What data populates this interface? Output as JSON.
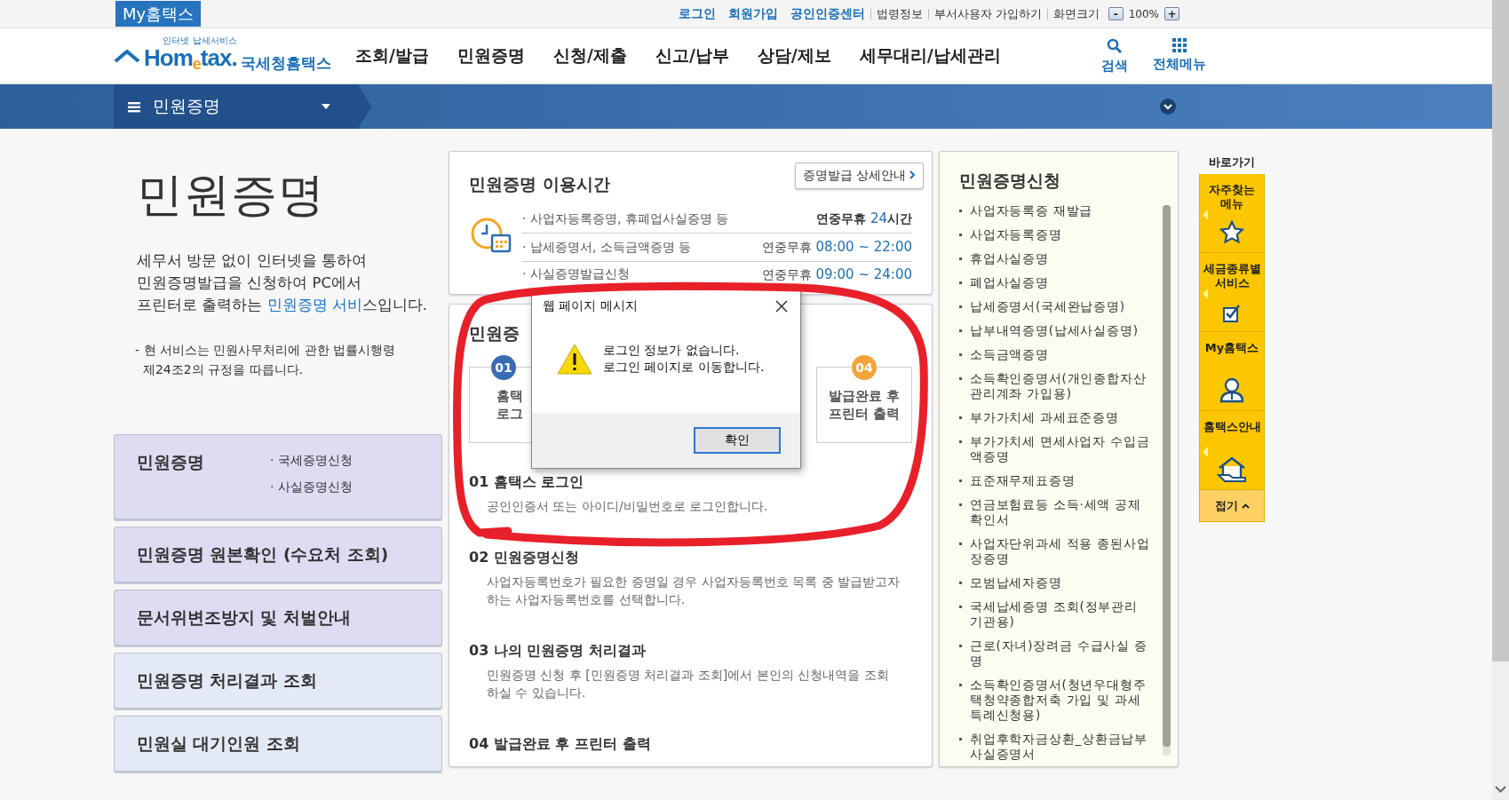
{
  "top_bar": {
    "badge": "My홈택스",
    "links": [
      {
        "label": "로그인",
        "kind": "primary"
      },
      {
        "label": "회원가입",
        "kind": "primary"
      },
      {
        "label": "공인인증센터",
        "kind": "primary"
      },
      {
        "label": "법령정보",
        "kind": "plain"
      },
      {
        "label": "부서사용자 가입하기",
        "kind": "plain"
      },
      {
        "label": "화면크기",
        "kind": "plain"
      }
    ],
    "zoom": {
      "minus": "-",
      "value": "100%",
      "plus": "+"
    }
  },
  "header": {
    "logo_tagline": "인터넷 납세서비스",
    "logo": "Hom$_{e}$tax.",
    "logo_name": "국세청홈택스",
    "nav": [
      "조회/발급",
      "민원증명",
      "신청/제출",
      "신고/납부",
      "상담/제보",
      "세무대리/납세관리"
    ],
    "tools": [
      {
        "label": "검색",
        "kind": "search"
      },
      {
        "label": "전체메뉴",
        "kind": "grid"
      }
    ]
  },
  "breadcrumb": {
    "label": "민원증명"
  },
  "intro": {
    "title": "민원증명",
    "description": "세무서 방문 없이 인터넷을 통하여\n민원증명발급을 신청하여 PC에서\n프린터로 출력하는 ",
    "link": "민원증명 서비",
    "description_end": "스입니다.",
    "note": "- 현 서비스는 민원사무처리에 관한 법률시행령\n  제24조2의 규정을 따릅니다."
  },
  "menu_cards": [
    {
      "title": "민원증명",
      "color": "#dddcf3",
      "links": [
        "· 국세증명신청",
        "· 사실증명신청"
      ]
    },
    {
      "title": "민원증명 원본확인 (수요처 조회)",
      "color": "#dddcf3"
    },
    {
      "title": "문서위변조방지 및 처벌안내",
      "color": "#dddcf3"
    },
    {
      "title": "민원증명 처리결과 조회",
      "color": "#e3eaf5"
    },
    {
      "title": "민원실 대기인원 조회",
      "color": "#e3eaf5"
    }
  ],
  "hours": {
    "title": "민원증명 이용시간",
    "button": "증명발급 상세안내",
    "rows": [
      {
        "label": "· 사업자등록증명, 휴폐업사실증명 등",
        "prefix": "연중무휴",
        "time": "24",
        "unit": "시간"
      },
      {
        "label": "· 납세증명서, 소득금액증명 등",
        "prefix": "연중무휴",
        "time": "08:00 ~ 22:00"
      },
      {
        "label": "· 사실증명발급신청",
        "prefix": "연중무휴",
        "time": "09:00 ~ 24:00"
      }
    ]
  },
  "procedure": {
    "title": "민원증",
    "cards": [
      {
        "number": "01",
        "text": "홈택\n로그",
        "color": "#3a6cb3"
      },
      {
        "number": "04",
        "text": "발급완료 후\n프린터 출력",
        "color": "#f4a43a"
      }
    ],
    "steps": [
      {
        "title": "01 홈택스 로그인",
        "text": "공인인증서 또는 아이디/비밀번호로 로그인합니다."
      },
      {
        "title": "02 민원증명신청",
        "text": "사업자등록번호가 필요한 증명일 경우 사업자등록번호 목록 중 발급받고자\n하는 사업자등록번호를 선택합니다."
      },
      {
        "title": "03 나의 민원증명 처리결과",
        "text": "민원증명 신청 후 [민원증명 처리결과 조회]에서 본인의 신청내역을 조회\n하실 수 있습니다."
      },
      {
        "title": "04 발급완료 후 프린터 출력"
      }
    ]
  },
  "request": {
    "title": "민원증명신청",
    "items": [
      "사업자등록증 재발급",
      "사업자등록증명",
      "휴업사실증명",
      "폐업사실증명",
      "납세증명서(국세완납증명)",
      "납부내역증명(납세사실증명)",
      "소득금액증명",
      "소득확인증명서(개인종합자산관리계좌 가입용)",
      "부가가치세 과세표준증명",
      "부가가치세 면세사업자 수입금액증명",
      "표준재무제표증명",
      "연금보험료등 소득·세액 공제확인서",
      "사업자단위과세 적용 종된사업장증명",
      "모범납세자증명",
      "국세납세증명 조회(정부관리기관용)",
      "근로(자녀)장려금 수급사실 증명",
      "소득확인증명서(청년우대형주택청약종합저축 가입 및 과세특례신청용)",
      "취업후학자금상환_상환금납부사실증명서"
    ]
  },
  "quick": {
    "title": "바로가기",
    "items": [
      {
        "label": "자주찾는\n메뉴",
        "kind": "star",
        "pointer": true
      },
      {
        "label": "세금종류별\n서비스",
        "kind": "check",
        "pointer": true
      },
      {
        "label": "My홈택스",
        "kind": "person",
        "pointer": false
      },
      {
        "label": "홈택스안내",
        "kind": "house",
        "pointer": true
      }
    ],
    "collapse": "접기"
  },
  "dialog": {
    "title": "웹 페이지 메시지",
    "message": "로그인 정보가 없습니다.\n로그인 페이지로 이동합니다.",
    "button": "확인"
  }
}
